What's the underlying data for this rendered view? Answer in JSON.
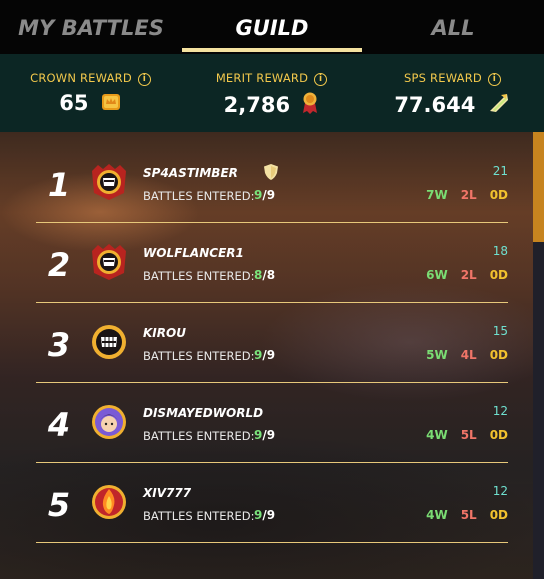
{
  "tabs": [
    {
      "label": "MY BATTLES",
      "active": false
    },
    {
      "label": "GUILD",
      "active": true
    },
    {
      "label": "ALL",
      "active": false
    }
  ],
  "rewards": [
    {
      "label": "CROWN REWARD",
      "value": "65",
      "icon": "crown-token-icon"
    },
    {
      "label": "MERIT REWARD",
      "value": "2,786",
      "icon": "merit-medal-icon"
    },
    {
      "label": "SPS REWARD",
      "value": "77.644",
      "icon": "sps-token-icon"
    }
  ],
  "battles_entered_label": "BATTLES ENTERED:",
  "players": [
    {
      "rank": "1",
      "name": "SP4ASTIMBER",
      "entered": "9",
      "total": "9",
      "score": "21",
      "wins": "7W",
      "losses": "2L",
      "draws": "0D",
      "avatar": "guild-crest-avatar",
      "badge": "shield-icon"
    },
    {
      "rank": "2",
      "name": "WOLFLANCER1",
      "entered": "8",
      "total": "8",
      "score": "18",
      "wins": "6W",
      "losses": "2L",
      "draws": "0D",
      "avatar": "guild-crest-avatar"
    },
    {
      "rank": "3",
      "name": "KIROU",
      "entered": "9",
      "total": "9",
      "score": "15",
      "wins": "5W",
      "losses": "4L",
      "draws": "0D",
      "avatar": "monster-avatar"
    },
    {
      "rank": "4",
      "name": "DISMAYEDWORLD",
      "entered": "9",
      "total": "9",
      "score": "12",
      "wins": "4W",
      "losses": "5L",
      "draws": "0D",
      "avatar": "character-avatar"
    },
    {
      "rank": "5",
      "name": "XIV777",
      "entered": "9",
      "total": "9",
      "score": "12",
      "wins": "4W",
      "losses": "5L",
      "draws": "0D",
      "avatar": "fire-avatar"
    }
  ],
  "colors": {
    "accent_gold": "#f2c84c",
    "win": "#7adc73",
    "loss": "#f07568",
    "draw": "#f2c22e",
    "score": "#6fe0cf",
    "scroll_thumb": "#c7841f"
  }
}
